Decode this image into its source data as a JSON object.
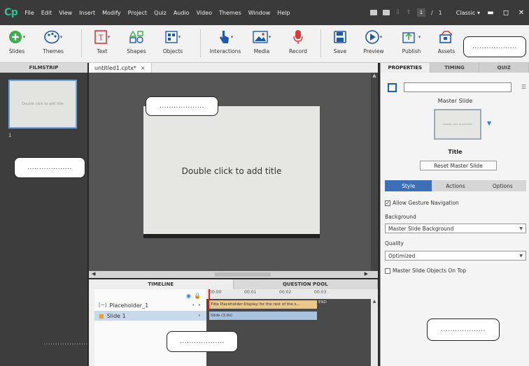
{
  "app": {
    "logo": "Cp"
  },
  "menu": [
    "File",
    "Edit",
    "View",
    "Insert",
    "Modify",
    "Project",
    "Quiz",
    "Audio",
    "Video",
    "Themes",
    "Window",
    "Help"
  ],
  "navigation": {
    "current_page": "1",
    "separator": "/",
    "total_pages": "1"
  },
  "workspace": {
    "label": "Classic",
    "dropdown": "▾"
  },
  "window_controls": {
    "minimize": "▬",
    "maximize": "◻",
    "close": "✕"
  },
  "toolbar": {
    "slides": "Slides",
    "themes": "Themes",
    "text": "Text",
    "shapes": "Shapes",
    "objects": "Objects",
    "interactions": "Interactions",
    "media": "Media",
    "record": "Record",
    "save": "Save",
    "preview": "Preview",
    "publish": "Publish",
    "assets": "Assets"
  },
  "filmstrip": {
    "title": "FILMSTRIP",
    "thumb_text": "Double click to add title",
    "slide_number": "1"
  },
  "document": {
    "tab_label": "untitled1.cptx*",
    "close": "×"
  },
  "stage": {
    "slide_title": "Double click to add title"
  },
  "timeline": {
    "tabs": [
      "TIMELINE",
      "QUESTION POOL"
    ],
    "rows": [
      {
        "icon": "[~]",
        "label": "Placeholder_1"
      },
      {
        "icon": "■",
        "label": "Slide 1"
      }
    ],
    "ruler_ticks": [
      "00:00",
      "00:01",
      "00:02",
      "00:03"
    ],
    "bar_placeholder": "Title Placeholder:Display for the rest of the s...",
    "bar_slide": "Slide (3.0s)",
    "end_marker": "END"
  },
  "properties": {
    "tabs": [
      "PROPERTIES",
      "TIMING",
      "QUIZ"
    ],
    "master_slide_label": "Master Slide",
    "master_thumb_text": "Double click to add title",
    "layout_name": "Title",
    "reset_button": "Reset Master Slide",
    "sub_tabs": [
      "Style",
      "Actions",
      "Options"
    ],
    "allow_gesture": "Allow Gesture Navigation",
    "background_label": "Background",
    "background_value": "Master Slide Background",
    "quality_label": "Quality",
    "quality_value": "Optimized",
    "master_objects_on_top": "Master Slide Objects On Top"
  },
  "placeholders": {
    "toolbar": "...................",
    "slide": "...................",
    "filmstrip": "...................",
    "filmstrip_bottom": "...................",
    "timeline": "...................",
    "properties": "..................."
  },
  "colors": {
    "accent": "#3d6fb6",
    "logo": "#2fc09a",
    "record": "#d93a3a",
    "selection": "#6aa3e0"
  }
}
